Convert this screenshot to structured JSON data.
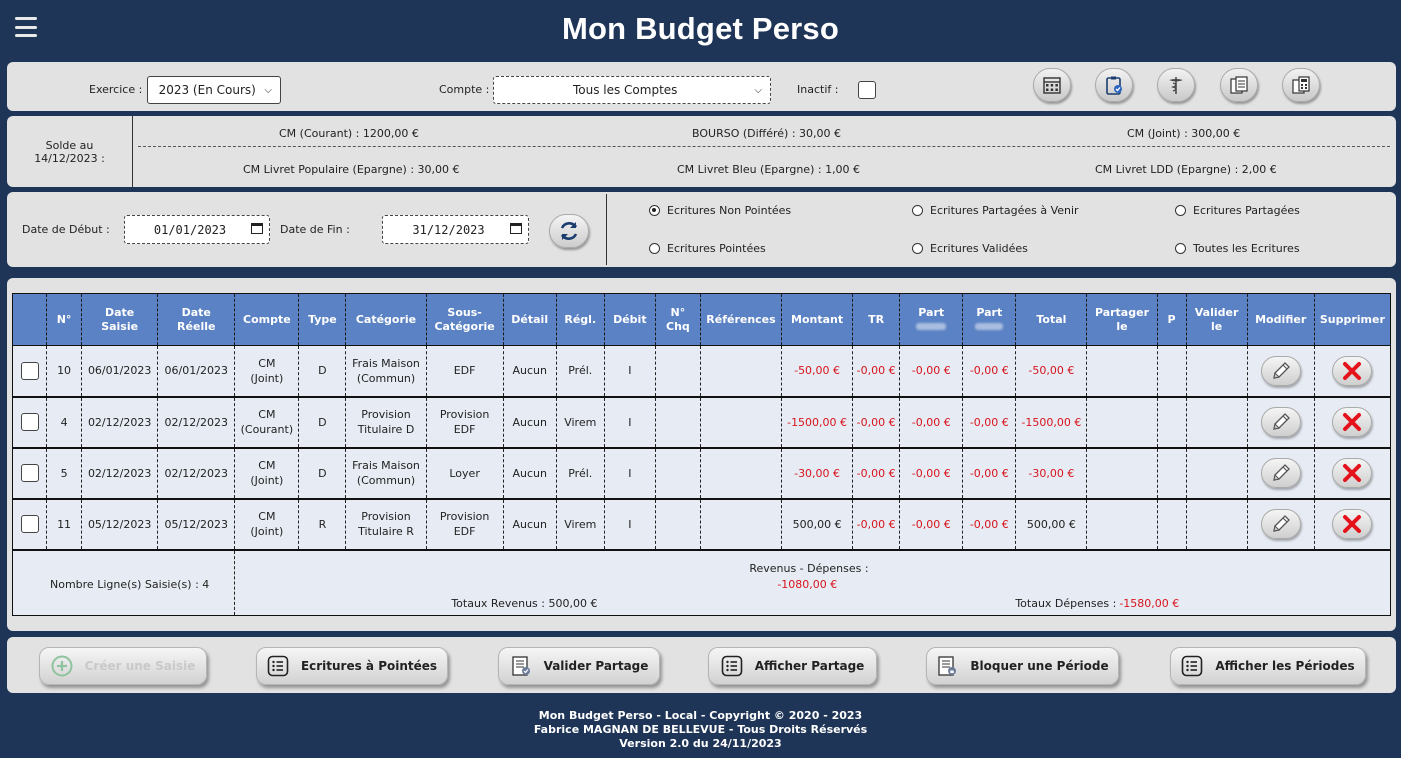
{
  "header": {
    "title": "Mon Budget Perso"
  },
  "filters": {
    "exercice_label": "Exercice :",
    "exercice_value": "2023 (En Cours)",
    "compte_label": "Compte :",
    "compte_value": "Tous les Comptes",
    "inactif_label": "Inactif :",
    "icons": [
      "calendar-grid-icon",
      "clipboard-check-icon",
      "caduceus-icon",
      "ledger-icon",
      "calculator-icon"
    ]
  },
  "balances": {
    "label_line1": "Solde au",
    "label_line2": "14/12/2023 :",
    "row1": [
      "CM (Courant) : 1200,00 €",
      "BOURSO (Différé) : 30,00 €",
      "CM (Joint) : 300,00 €"
    ],
    "row2": [
      "CM Livret Populaire (Epargne) : 30,00 €",
      "CM Livret Bleu (Epargne) : 1,00 €",
      "CM Livret LDD (Epargne) : 2,00 €"
    ]
  },
  "dates": {
    "start_label": "Date de Début :",
    "start_value": "01/01/2023",
    "end_label": "Date de Fin :",
    "end_value": "31/12/2023"
  },
  "radios": [
    {
      "label": "Ecritures Non Pointées",
      "checked": true
    },
    {
      "label": "Ecritures Partagées à Venir",
      "checked": false
    },
    {
      "label": "Ecritures Partagées",
      "checked": false
    },
    {
      "label": "Ecritures Pointées",
      "checked": false
    },
    {
      "label": "Ecritures Validées",
      "checked": false
    },
    {
      "label": "Toutes les Ecritures",
      "checked": false
    }
  ],
  "table": {
    "headers": {
      "no": "N°",
      "date_saisie_1": "Date",
      "date_saisie_2": "Saisie",
      "date_reelle_1": "Date",
      "date_reelle_2": "Réelle",
      "compte": "Compte",
      "type": "Type",
      "categorie": "Catégorie",
      "sous_categorie_1": "Sous-",
      "sous_categorie_2": "Catégorie",
      "detail": "Détail",
      "regl": "Régl.",
      "debit": "Débit",
      "chq_1": "N°",
      "chq_2": "Chq",
      "references": "Références",
      "montant": "Montant",
      "tr": "TR",
      "part1": "Part",
      "part2": "Part",
      "total": "Total",
      "partager_1": "Partager",
      "partager_2": "le",
      "p": "P",
      "valider_1": "Valider",
      "valider_2": "le",
      "modifier": "Modifier",
      "supprimer": "Supprimer"
    },
    "rows": [
      {
        "no": "10",
        "date_saisie": "06/01/2023",
        "date_reelle": "06/01/2023",
        "compte_1": "CM",
        "compte_2": "(Joint)",
        "type": "D",
        "cat_1": "Frais Maison",
        "cat_2": "(Commun)",
        "sous_cat_1": "EDF",
        "sous_cat_2": "",
        "detail": "Aucun",
        "regl": "Prél.",
        "debit": "I",
        "chq": "",
        "references": "",
        "montant": "-50,00 €",
        "tr": "-0,00 €",
        "part1": "-0,00 €",
        "part2": "-0,00 €",
        "total": "-50,00 €",
        "partager": "",
        "p": "",
        "valider": ""
      },
      {
        "no": "4",
        "date_saisie": "02/12/2023",
        "date_reelle": "02/12/2023",
        "compte_1": "CM",
        "compte_2": "(Courant)",
        "type": "D",
        "cat_1": "Provision",
        "cat_2": "Titulaire D",
        "sous_cat_1": "Provision",
        "sous_cat_2": "EDF",
        "detail": "Aucun",
        "regl": "Virem",
        "debit": "I",
        "chq": "",
        "references": "",
        "montant": "-1500,00 €",
        "tr": "-0,00 €",
        "part1": "-0,00 €",
        "part2": "-0,00 €",
        "total": "-1500,00 €",
        "partager": "",
        "p": "",
        "valider": ""
      },
      {
        "no": "5",
        "date_saisie": "02/12/2023",
        "date_reelle": "02/12/2023",
        "compte_1": "CM",
        "compte_2": "(Joint)",
        "type": "D",
        "cat_1": "Frais Maison",
        "cat_2": "(Commun)",
        "sous_cat_1": "Loyer",
        "sous_cat_2": "",
        "detail": "Aucun",
        "regl": "Prél.",
        "debit": "I",
        "chq": "",
        "references": "",
        "montant": "-30,00 €",
        "tr": "-0,00 €",
        "part1": "-0,00 €",
        "part2": "-0,00 €",
        "total": "-30,00 €",
        "partager": "",
        "p": "",
        "valider": ""
      },
      {
        "no": "11",
        "date_saisie": "05/12/2023",
        "date_reelle": "05/12/2023",
        "compte_1": "CM",
        "compte_2": "(Joint)",
        "type": "R",
        "cat_1": "Provision",
        "cat_2": "Titulaire R",
        "sous_cat_1": "Provision",
        "sous_cat_2": "EDF",
        "detail": "Aucun",
        "regl": "Virem",
        "debit": "I",
        "chq": "",
        "references": "",
        "montant": "500,00 €",
        "tr": "-0,00 €",
        "part1": "-0,00 €",
        "part2": "-0,00 €",
        "total": "500,00 €",
        "partager": "",
        "p": "",
        "valider": ""
      }
    ],
    "footer": {
      "count_label": "Nombre Ligne(s) Saisie(s) : 4",
      "diff_label": "Revenus - Dépenses :",
      "diff_value": "-1080,00 €",
      "revenus_label": "Totaux Revenus : 500,00 €",
      "depenses_label": "Totaux Dépenses :",
      "depenses_value": "-1580,00 €"
    }
  },
  "actions": {
    "create": "Créer une Saisie",
    "pointer": "Ecritures à Pointées",
    "valider": "Valider Partage",
    "afficher_partage": "Afficher Partage",
    "bloquer": "Bloquer une Période",
    "afficher_periodes": "Afficher les Périodes"
  },
  "footer": {
    "line1": "Mon Budget Perso - Local - Copyright © 2020 - 2023",
    "line2": "Fabrice MAGNAN DE BELLEVUE - Tous Droits Réservés",
    "line3": "Version 2.0 du 24/11/2023"
  },
  "colors": {
    "background": "#1e3557",
    "panel": "#e2e2e2",
    "table_header": "#5b82c4",
    "negative": "#d8141d"
  }
}
